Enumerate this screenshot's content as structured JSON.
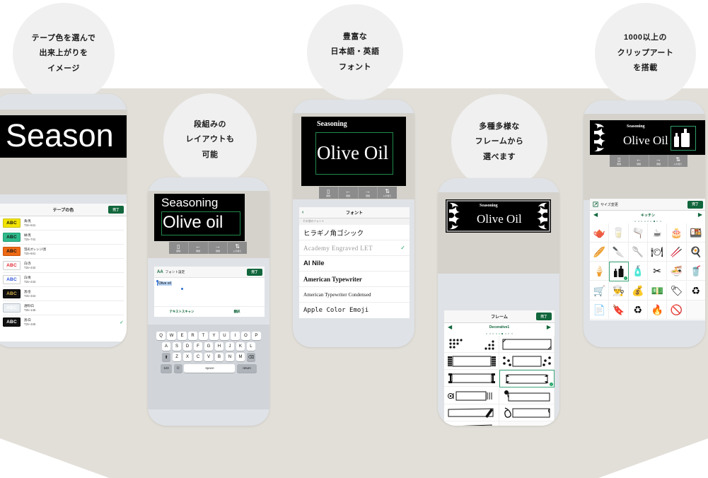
{
  "page": {
    "background_color": "#ffffff",
    "stage_color": "#e2dfd9",
    "accent_green": "#11663c",
    "bubble_color": "#f0f0f0"
  },
  "bubbles": [
    {
      "id": "bubble-tape-color",
      "lines": [
        "テープ色を選んで",
        "出来上がりを",
        "イメージ"
      ]
    },
    {
      "id": "bubble-layout",
      "lines": [
        "段組みの",
        "レイアウトも",
        "可能"
      ]
    },
    {
      "id": "bubble-fonts",
      "lines": [
        "豊富な",
        "日本語・英語",
        "フォント"
      ]
    },
    {
      "id": "bubble-frames",
      "lines": [
        "多種多様な",
        "フレームから",
        "選べます"
      ]
    },
    {
      "id": "bubble-clipart",
      "lines": [
        "1000以上の",
        "クリップアート",
        "を搭載"
      ]
    }
  ],
  "toolbar": {
    "items": [
      {
        "glyph": "▯",
        "label": "削除"
      },
      {
        "glyph": "←",
        "label": "移動"
      },
      {
        "glyph": "→",
        "label": "移動"
      },
      {
        "glyph": "⇅",
        "label": "入れ替え"
      }
    ]
  },
  "done_label": "完了",
  "phone1": {
    "label_preview": {
      "text": "Season"
    },
    "sheet": {
      "title": "テープの色",
      "done": "完了",
      "rows": [
        {
          "swatch_text": "ABC",
          "bg": "#f2e400",
          "fg": "#111111",
          "border": "#c9bf00",
          "name": "黄/黒",
          "code": "TZe-641",
          "checked": false
        },
        {
          "swatch_text": "ABC",
          "bg": "#2fba8c",
          "fg": "#111111",
          "border": "#1e9e74",
          "name": "緑/黒",
          "code": "TZe-741",
          "checked": false
        },
        {
          "swatch_text": "ABC",
          "bg": "#ef6a14",
          "fg": "#111111",
          "border": "#c9530a",
          "name": "蛍光オレンジ/黒",
          "code": "TZe-841",
          "checked": false
        },
        {
          "swatch_text": "ABC",
          "bg": "#ffffff",
          "fg": "#e0232e",
          "border": "#cfcfcf",
          "name": "白/赤",
          "code": "TZe-242",
          "checked": false
        },
        {
          "swatch_text": "ABC",
          "bg": "#ffffff",
          "fg": "#2b50d8",
          "border": "#cfcfcf",
          "name": "白/青",
          "code": "TZe-243",
          "checked": false
        },
        {
          "swatch_text": "ABC",
          "bg": "#111111",
          "fg": "#d8b24a",
          "border": "#000000",
          "name": "黒/金",
          "code": "TZe-344",
          "checked": false
        },
        {
          "swatch_text": "ABC",
          "bg": "#e9eef2",
          "fg": "#ffffff",
          "border": "#b8c2ca",
          "name": "透明/白",
          "code": "TZe-145",
          "checked": false
        },
        {
          "swatch_text": "ABC",
          "bg": "#111111",
          "fg": "#ffffff",
          "border": "#000000",
          "name": "黒/白",
          "code": "TZe-345",
          "checked": true
        }
      ]
    }
  },
  "phone2": {
    "label_preview": {
      "line1": "Seasoning",
      "line2": "Olive oil"
    },
    "editor": {
      "aa_icon": "AA",
      "title": "フォント設定",
      "done": "完了",
      "selected_text": "Olive oil",
      "text_scan": "テキストスキャン",
      "translate": "翻訳"
    },
    "keyboard": {
      "row1": [
        "Q",
        "W",
        "E",
        "R",
        "T",
        "Y",
        "U",
        "I",
        "O",
        "P"
      ],
      "row2": [
        "A",
        "S",
        "D",
        "F",
        "G",
        "H",
        "J",
        "K",
        "L"
      ],
      "row3": [
        "Z",
        "X",
        "C",
        "V",
        "B",
        "N",
        "M"
      ],
      "shift": "⬆",
      "backspace": "⌫",
      "numbers": "123",
      "emoji": "☺",
      "space": "space",
      "return": "return"
    }
  },
  "phone3": {
    "label_preview": {
      "line1": "Seasoning",
      "line2": "Olive Oil"
    },
    "nav": {
      "back": "‹",
      "title": "フォント"
    },
    "sub_head": "その他のフォント",
    "fonts": [
      {
        "name": "ヒラギノ角ゴシック",
        "style": "jp",
        "checked": false
      },
      {
        "name": "Academy Engraved LET",
        "style": "engraved",
        "checked": true
      },
      {
        "name": "Al Nile",
        "style": "bold-sans",
        "checked": false
      },
      {
        "name": "American Typewriter",
        "style": "typewriter",
        "checked": false
      },
      {
        "name": "American Typewriter Condensed",
        "style": "typewriter-condensed",
        "checked": false
      },
      {
        "name": "Apple Color Emoji",
        "style": "mono",
        "checked": false
      }
    ]
  },
  "phone4": {
    "label_preview": {
      "line1": "Seasoning",
      "line2": "Olive Oil"
    },
    "sheet": {
      "title": "フレーム",
      "done": "完了"
    },
    "category": {
      "name": "Decorative1",
      "left_arrow": "◀",
      "right_arrow": "▶",
      "dots_total": 9,
      "dots_active_index": 5
    },
    "frames_count": 11,
    "selected_frame_index": 5
  },
  "phone5": {
    "label_preview": {
      "line1": "Seasoning",
      "line2": "Olive Oil"
    },
    "sheet": {
      "icon": "resize-icon",
      "title": "サイズ変更",
      "done": "完了"
    },
    "category": {
      "name": "キッチン",
      "left_arrow": "◀",
      "right_arrow": "▶",
      "dots_total": 9,
      "dots_active_index": 6
    },
    "clipart": [
      "🫖",
      "🥛",
      "🫗",
      "☕",
      "🎂",
      "🍱",
      "🥖",
      "🔪",
      "🥄",
      "🍽",
      "🥢",
      "🍳",
      "🍦",
      "🍶",
      "🧴",
      "✂",
      "🍜",
      "🥤",
      "🛒",
      "👨‍🍳",
      "💰",
      "💵",
      "🏷",
      "♻",
      "📄",
      "🔖",
      "♻",
      "🔥",
      "🚫"
    ],
    "selected_clipart_index": 13
  }
}
